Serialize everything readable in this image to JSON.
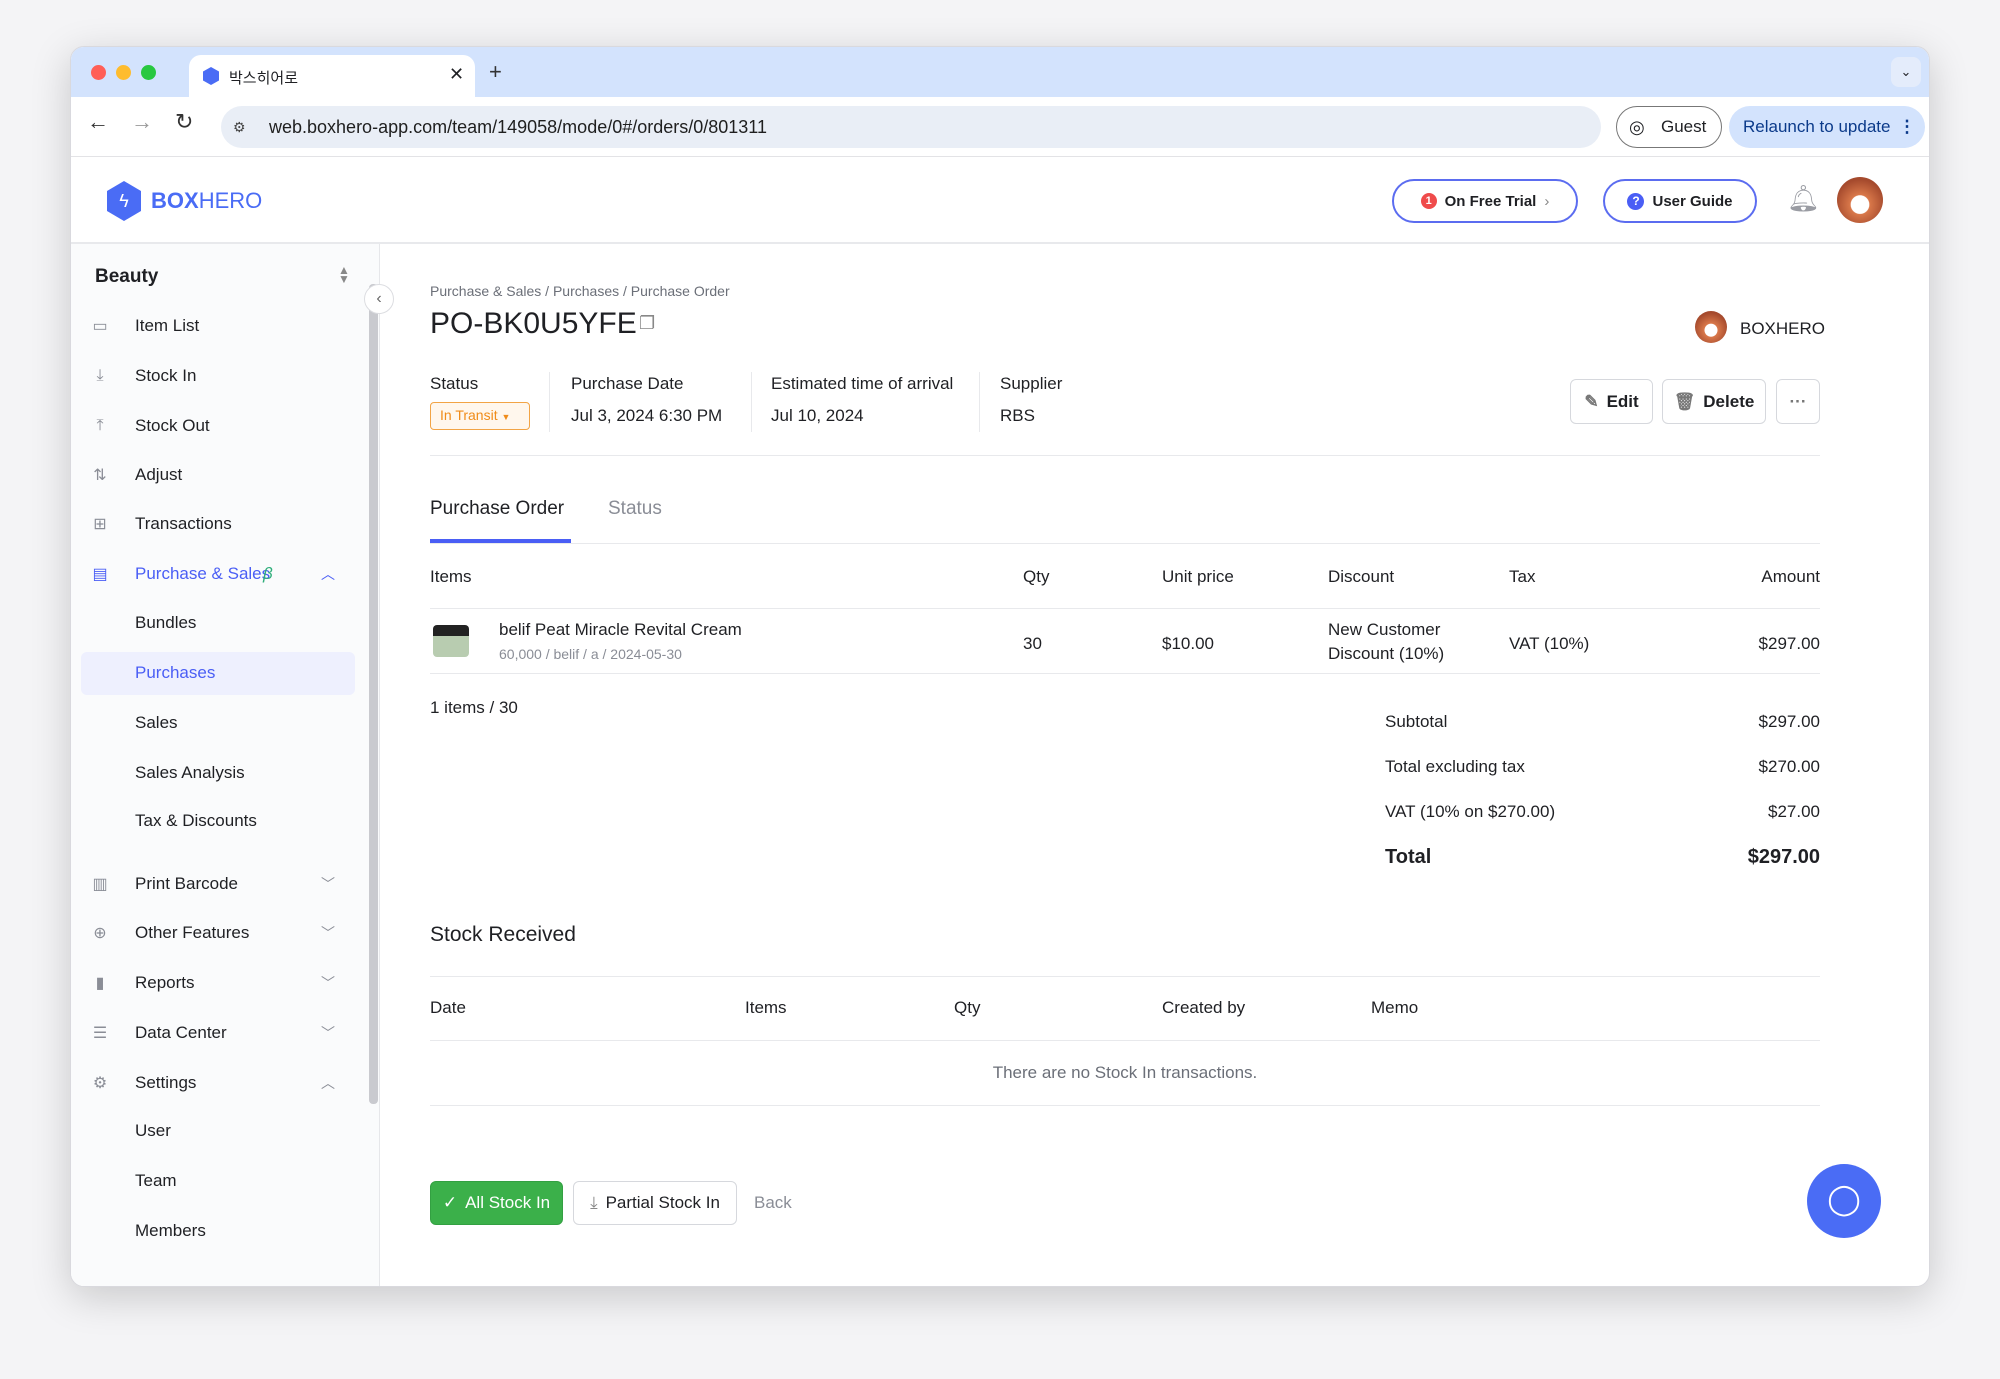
{
  "browser": {
    "tab_title": "박스히어로",
    "url": "web.boxhero-app.com/team/149058/mode/0#/orders/0/801311",
    "guest": "Guest",
    "relaunch": "Relaunch to update"
  },
  "header": {
    "logo_bold": "BOX",
    "logo_light": "HERO",
    "trial": "On Free Trial",
    "trial_badge": "1",
    "guide": "User Guide",
    "accent": "#4a5ef5"
  },
  "sidebar": {
    "team": "Beauty",
    "items": [
      {
        "label": "Item List",
        "icon": "box-icon"
      },
      {
        "label": "Stock In",
        "icon": "arrow-down-icon"
      },
      {
        "label": "Stock Out",
        "icon": "arrow-up-icon"
      },
      {
        "label": "Adjust",
        "icon": "swap-icon"
      },
      {
        "label": "Transactions",
        "icon": "transactions-icon"
      },
      {
        "label": "Purchase & Sales",
        "icon": "document-icon",
        "badge": "β"
      }
    ],
    "sub1": [
      "Bundles",
      "Purchases",
      "Sales",
      "Sales Analysis",
      "Tax & Discounts"
    ],
    "groups": [
      {
        "label": "Print Barcode",
        "icon": "barcode-icon"
      },
      {
        "label": "Other Features",
        "icon": "plus-circle-icon"
      },
      {
        "label": "Reports",
        "icon": "chart-icon"
      },
      {
        "label": "Data Center",
        "icon": "database-icon"
      },
      {
        "label": "Settings",
        "icon": "gear-icon"
      }
    ],
    "sub2": [
      "User",
      "Team",
      "Members"
    ]
  },
  "breadcrumb": [
    "Purchase & Sales",
    "Purchases",
    "Purchase Order"
  ],
  "order": {
    "id": "PO-BK0U5YFE",
    "owner": "BOXHERO",
    "fields": {
      "status_label": "Status",
      "status": "In Transit",
      "date_label": "Purchase Date",
      "date": "Jul 3, 2024 6:30 PM",
      "eta_label": "Estimated time of arrival",
      "eta": "Jul 10, 2024",
      "supplier_label": "Supplier",
      "supplier": "RBS"
    },
    "edit": "Edit",
    "delete": "Delete"
  },
  "tabs": [
    "Purchase Order",
    "Status"
  ],
  "items_table": {
    "headers": [
      "Items",
      "Qty",
      "Unit price",
      "Discount",
      "Tax",
      "Amount"
    ],
    "rows": [
      {
        "name": "belif Peat Miracle Revital Cream",
        "meta": "60,000 / belif / a / 2024-05-30",
        "qty": "30",
        "price": "$10.00",
        "discount1": "New Customer",
        "discount2": "Discount (10%)",
        "tax": "VAT (10%)",
        "amount": "$297.00"
      }
    ],
    "count": "1 items / 30"
  },
  "summary": [
    {
      "label": "Subtotal",
      "value": "$297.00"
    },
    {
      "label": "Total excluding tax",
      "value": "$270.00"
    },
    {
      "label": "VAT (10% on $270.00)",
      "value": "$27.00"
    },
    {
      "label": "Total",
      "value": "$297.00"
    }
  ],
  "stock": {
    "title": "Stock Received",
    "headers": [
      "Date",
      "Items",
      "Qty",
      "Created by",
      "Memo"
    ],
    "empty": "There are no Stock In transactions."
  },
  "actions": {
    "all": "All Stock In",
    "partial": "Partial Stock In",
    "back": "Back"
  }
}
